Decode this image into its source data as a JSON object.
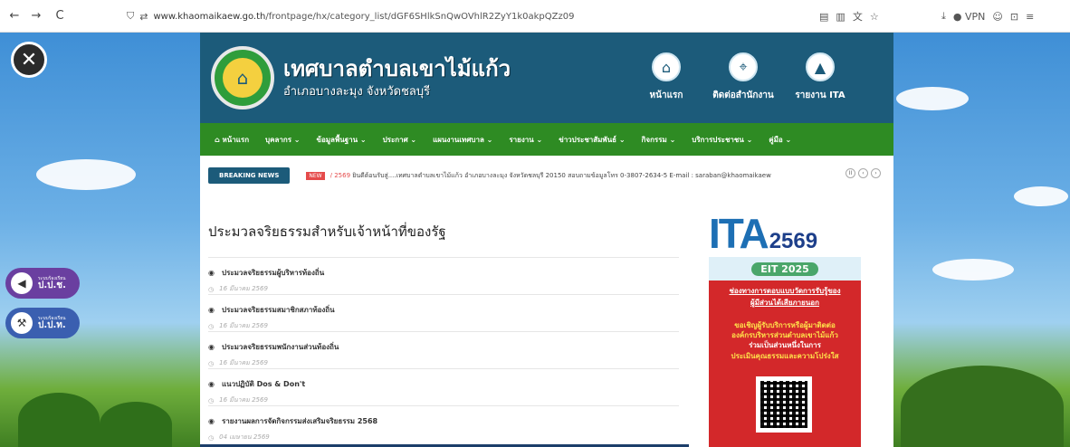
{
  "browser": {
    "back": "←",
    "forward": "→",
    "reload": "C",
    "url_host": "www.khaomaikaew.go.th",
    "url_path": "/frontpage/hx/category_list/dGF6SHlkSnQwOVhlR2ZyY1k0akpQZz09",
    "vpn_label": "VPN"
  },
  "side": {
    "btn1_small": "ระบบร้องเรียน",
    "btn1_big": "ป.ป.ช.",
    "btn2_small": "ระบบร้องเรียน",
    "btn2_big": "ป.ป.ท."
  },
  "header": {
    "title": "เทศบาลตำบลเขาไม้แก้ว",
    "subtitle": "อำเภอบางละมุง จังหวัดชลบุรี",
    "links": [
      "หน้าแรก",
      "ติดต่อสำนักงาน",
      "รายงาน ITA"
    ]
  },
  "menu": [
    "หน้าแรก",
    "บุคลากร ⌄",
    "ข้อมูลพื้นฐาน ⌄",
    "ประกาศ ⌄",
    "แผนงานเทศบาล ⌄",
    "รายงาน ⌄",
    "ข่าวประชาสัมพันธ์ ⌄",
    "กิจกรรม ⌄",
    "บริการประชาชน ⌄",
    "คู่มือ ⌄"
  ],
  "breaking": {
    "label": "BREAKING NEWS",
    "new_tag": "NEW",
    "year": "/ 2569",
    "text": "ยินดีต้อนรับสู่....เทศบาลตำบลเขาไม้แก้ว อำเภอบางละมุง จังหวัดชลบุรี 20150 สอบถามข้อมูลโทร 0-3807-2634-5 E-mail : saraban@khaomaikaew"
  },
  "content": {
    "page_title": "ประมวลจริยธรรมสำหรับเจ้าหน้าที่ของรัฐ",
    "articles": [
      {
        "title": "ประมวลจริยธรรมผู้บริหารท้องถิ่น",
        "date": "16 มีนาคม 2569"
      },
      {
        "title": "ประมวลจริยธรรมสมาชิกสภาท้องถิ่น",
        "date": "16 มีนาคม 2569"
      },
      {
        "title": "ประมวลจริยธรรมพนักงานส่วนท้องถิ่น",
        "date": "16 มีนาคม 2569"
      },
      {
        "title": "แนวปฏิบัติ Dos & Don't",
        "date": "16 มีนาคม 2569"
      },
      {
        "title": "รายงานผลการจัดกิจกรรมส่งเสริมจริยธรรม 2568",
        "date": "04 เมษายน 2569"
      }
    ]
  },
  "ita": {
    "logo": "ITA",
    "year": "2569",
    "eit": "EIT 2025",
    "link_line1": "ช่องทางการตอบแบบวัดการรับรู้ของ",
    "link_line2": "ผู้มีส่วนได้เสียภายนอก",
    "invite_line1": "ขอเชิญผู้รับบริการหรือผู้มาติดต่อ",
    "invite_line2": "องค์กรบริหารส่วนตำบลเขาไม้แก้ว",
    "invite_line3": "ร่วมเป็นส่วนหนึ่งในการ",
    "invite_line4": "ประเมินคุณธรรมและความโปร่งใส"
  },
  "colors": {
    "header": "#1c5b7a",
    "menubar": "#2e8b23",
    "ita_red": "#d3282a"
  }
}
